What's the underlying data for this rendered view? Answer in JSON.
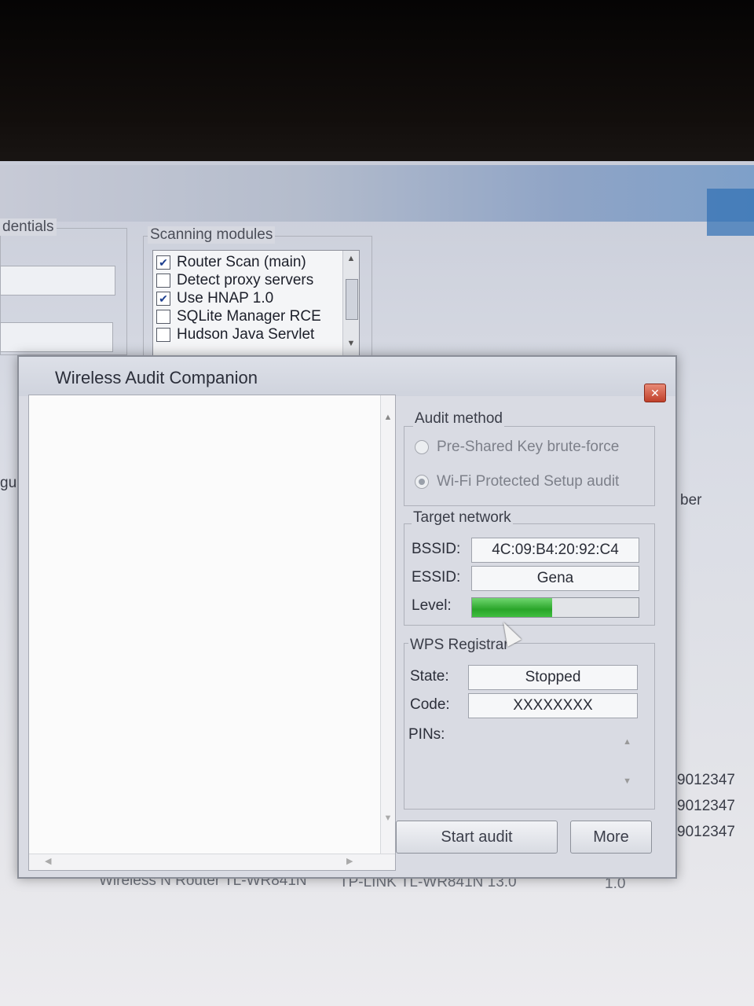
{
  "background": {
    "credentials_label": "dentials",
    "configure_label": "gure",
    "number_label": "ber",
    "scanning_modules_label": "Scanning modules",
    "modules": [
      {
        "label": "Router Scan (main)",
        "checked": true
      },
      {
        "label": "Detect proxy servers",
        "checked": false
      },
      {
        "label": "Use HNAP 1.0",
        "checked": true
      },
      {
        "label": "SQLite Manager RCE",
        "checked": false
      },
      {
        "label": "Hudson Java Servlet",
        "checked": false
      }
    ],
    "serial_rows": [
      "9012347",
      "9012347",
      "9012347"
    ],
    "bottom_row": {
      "name": "Wireless N Router TL-WR841N",
      "model": "TP-LINK TL-WR841N 13.0",
      "version": "1.0"
    }
  },
  "dialog": {
    "title": "Wireless Audit Companion",
    "close_glyph": "✕",
    "audit_method": {
      "legend": "Audit method",
      "options": [
        {
          "label": "Pre-Shared Key brute-force",
          "selected": false
        },
        {
          "label": "Wi-Fi Protected Setup audit",
          "selected": true
        }
      ]
    },
    "target_network": {
      "legend": "Target network",
      "bssid_label": "BSSID:",
      "bssid_value": "4C:09:B4:20:92:C4",
      "essid_label": "ESSID:",
      "essid_value": "Gena",
      "level_label": "Level:",
      "level_fraction": 0.48
    },
    "wps_registrar": {
      "legend": "WPS Registrar",
      "state_label": "State:",
      "state_value": "Stopped",
      "code_label": "Code:",
      "code_value": "XXXXXXXX",
      "pins_label": "PINs:"
    },
    "start_button": "Start audit",
    "more_button": "More"
  },
  "colors": {
    "level_fill": "#2aa52a",
    "close_button": "#c0402a"
  }
}
